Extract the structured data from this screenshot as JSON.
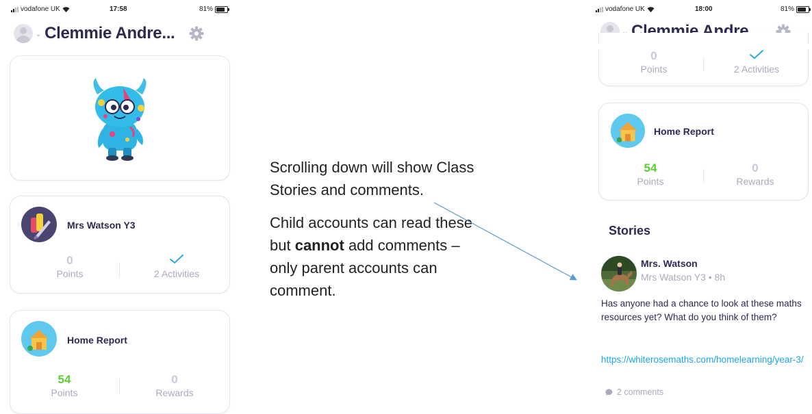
{
  "left_phone": {
    "status": {
      "carrier": "vodafone UK",
      "time": "17:58",
      "battery": "81%",
      "battery_level": 0.81
    },
    "header": {
      "student_name": "Clemmie Andre...",
      "chevron": "chevron-down-icon",
      "settings_icon": "gear-icon"
    },
    "monster_card": {
      "icon": "monster-avatar-icon"
    },
    "class_card": {
      "title": "Mrs Watson Y3",
      "points_value": "0",
      "points_label": "Points",
      "activities_label": "2 Activities",
      "activities_icon": "checkmark-icon"
    },
    "home_card": {
      "title": "Home Report",
      "points_value": "54",
      "points_label": "Points",
      "rewards_value": "0",
      "rewards_label": "Rewards"
    }
  },
  "note": {
    "para1": "Scrolling down will show Class Stories and comments.",
    "para2_pre": "Child accounts can read these but ",
    "para2_bold": "cannot",
    "para2_post": " add comments – only parent accounts can comment."
  },
  "right_phone": {
    "status": {
      "carrier": "vodafone UK",
      "time": "18:00",
      "battery": "81%",
      "battery_level": 0.81
    },
    "header": {
      "student_name": "Clemmie Andre..."
    },
    "class_card_partial": {
      "points_value": "0",
      "points_label": "Points",
      "activities_label": "2 Activities"
    },
    "home_card": {
      "title": "Home Report",
      "points_value": "54",
      "points_label": "Points",
      "rewards_value": "0",
      "rewards_label": "Rewards"
    },
    "stories": {
      "heading": "Stories",
      "author": "Mrs. Watson",
      "subline": "Mrs Watson Y3 • 8h",
      "body": "Has anyone had a chance to look at these maths resources yet? What do you think of them?",
      "link": "https://whiterosemaths.com/homelearning/year-3/",
      "comments": "2 comments"
    }
  },
  "colors": {
    "title": "#2c2a50",
    "points_green": "#5ccd33",
    "muted": "#a9abbc",
    "link": "#1aa6e8",
    "check": "#2ea6e6",
    "arrow": "#5b9bd5"
  }
}
